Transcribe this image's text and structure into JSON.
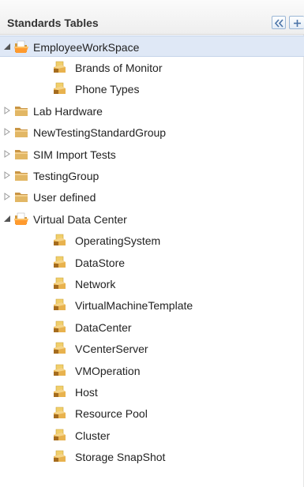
{
  "panel": {
    "title": "Standards Tables",
    "collapse_icon": "double-chevron-left-icon",
    "add_icon": "plus-icon"
  },
  "colors": {
    "selected_row": "#dfe8f6",
    "header_accent": "#9ab6d6",
    "folder_closed": "#e2b765",
    "folder_open": "#ff9a2e",
    "doc_page": "#f1cf6a"
  },
  "tree": [
    {
      "label": "EmployeeWorkSpace",
      "type": "group",
      "expanded": true,
      "selected": true
    },
    {
      "label": "Brands of Monitor",
      "type": "table"
    },
    {
      "label": "Phone Types",
      "type": "table"
    },
    {
      "label": "Lab Hardware",
      "type": "group",
      "expanded": false
    },
    {
      "label": "NewTestingStandardGroup",
      "type": "group",
      "expanded": false
    },
    {
      "label": "SIM Import Tests",
      "type": "group",
      "expanded": false
    },
    {
      "label": "TestingGroup",
      "type": "group",
      "expanded": false
    },
    {
      "label": "User defined",
      "type": "group",
      "expanded": false
    },
    {
      "label": "Virtual Data Center",
      "type": "group",
      "expanded": true
    },
    {
      "label": "OperatingSystem",
      "type": "table"
    },
    {
      "label": "DataStore",
      "type": "table"
    },
    {
      "label": "Network",
      "type": "table"
    },
    {
      "label": "VirtualMachineTemplate",
      "type": "table"
    },
    {
      "label": "DataCenter",
      "type": "table"
    },
    {
      "label": "VCenterServer",
      "type": "table"
    },
    {
      "label": "VMOperation",
      "type": "table"
    },
    {
      "label": "Host",
      "type": "table"
    },
    {
      "label": "Resource Pool",
      "type": "table"
    },
    {
      "label": "Cluster",
      "type": "table"
    },
    {
      "label": "Storage SnapShot",
      "type": "table"
    }
  ]
}
